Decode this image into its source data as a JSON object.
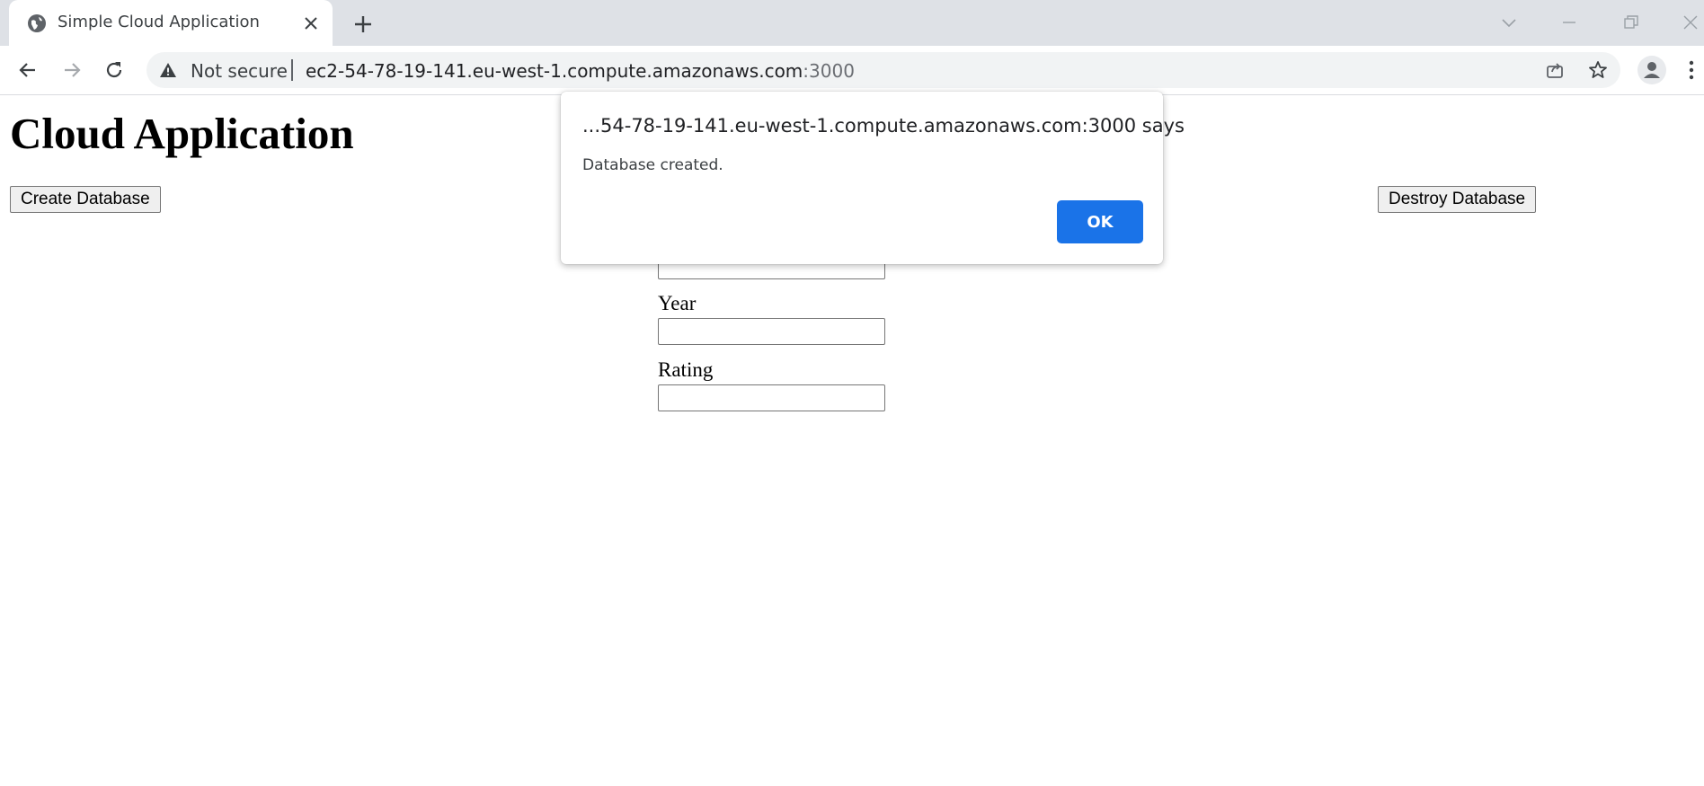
{
  "browser": {
    "tab": {
      "title": "Simple Cloud Application"
    },
    "address_bar": {
      "security_label": "Not secure",
      "url_host": "ec2-54-78-19-141.eu-west-1.compute.amazonaws.com",
      "url_port": ":3000"
    }
  },
  "page": {
    "title": "Cloud Application",
    "create_button": "Create Database",
    "destroy_button": "Destroy Database",
    "form": {
      "fields": [
        {
          "label": "",
          "value": ""
        },
        {
          "label": "Year",
          "value": ""
        },
        {
          "label": "Rating",
          "value": ""
        }
      ]
    }
  },
  "dialog": {
    "title": "...54-78-19-141.eu-west-1.compute.amazonaws.com:3000 says",
    "message": "Database created.",
    "ok_label": "OK"
  },
  "colors": {
    "accent": "#1a73e8",
    "tabstrip": "#dee1e6",
    "omnibox": "#f1f3f4"
  },
  "icons": {
    "tab_favicon": "globe-icon",
    "tab_close": "close-icon",
    "new_tab": "plus-icon",
    "security": "warning-triangle-icon",
    "share": "share-icon",
    "bookmark": "star-icon",
    "profile": "profile-icon",
    "menu": "three-dots-icon"
  }
}
